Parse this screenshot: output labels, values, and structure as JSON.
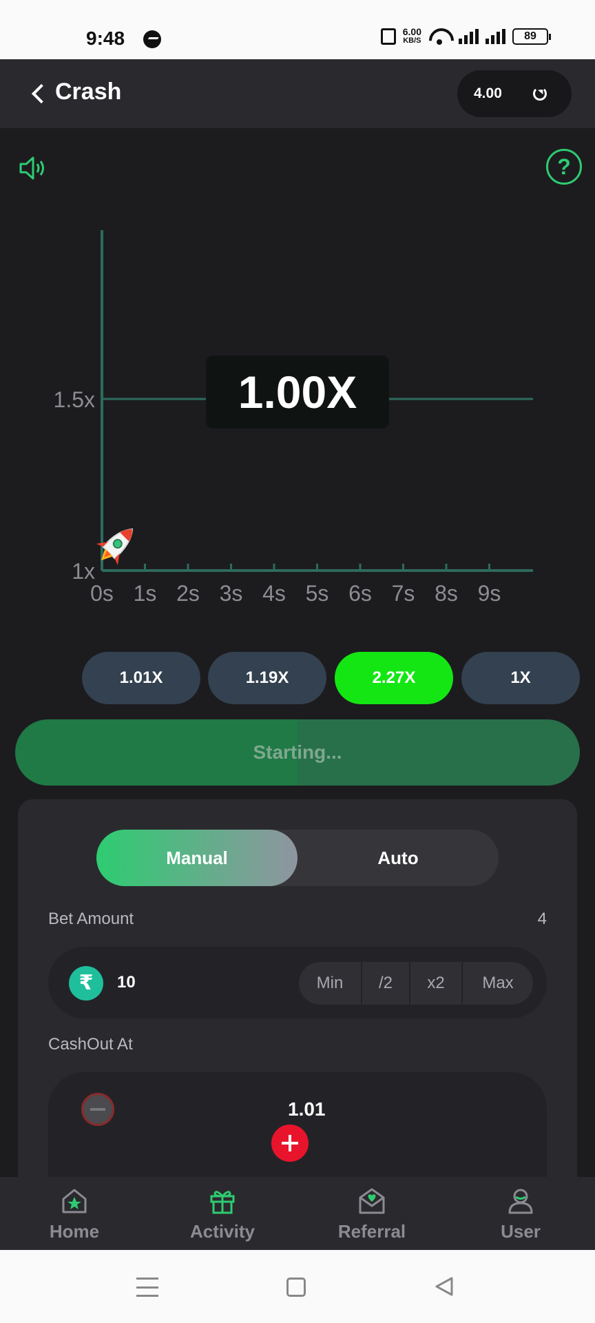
{
  "status_bar": {
    "time": "9:48",
    "net_speed": "6.00",
    "net_unit": "KB/S",
    "battery": "89"
  },
  "header": {
    "title": "Crash",
    "balance": "4.00"
  },
  "game": {
    "multiplier": "1.00X",
    "chart_data": {
      "type": "line",
      "x_ticks": [
        "0s",
        "1s",
        "2s",
        "3s",
        "4s",
        "5s",
        "6s",
        "7s",
        "8s",
        "9s"
      ],
      "y_ticks": [
        "1x",
        "1.5x"
      ],
      "series": [
        {
          "x": [
            0
          ],
          "y": [
            1.0
          ]
        }
      ]
    }
  },
  "history": [
    "1.01X",
    "1.19X",
    "2.27X",
    "1X"
  ],
  "start_button": "Starting...",
  "panel": {
    "tabs": {
      "manual": "Manual",
      "auto": "Auto"
    },
    "bet_label": "Bet Amount",
    "bet_count": "4",
    "currency_symbol": "₹",
    "bet_value": "10",
    "chips": [
      "Min",
      "/2",
      "x2",
      "Max"
    ],
    "cashout_label": "CashOut At",
    "cashout_value": "1.01"
  },
  "nav": [
    "Home",
    "Activity",
    "Referral",
    "User"
  ],
  "colors": {
    "accent": "#2ecc71",
    "active_pill": "#14e614",
    "plus": "#e8142c"
  }
}
